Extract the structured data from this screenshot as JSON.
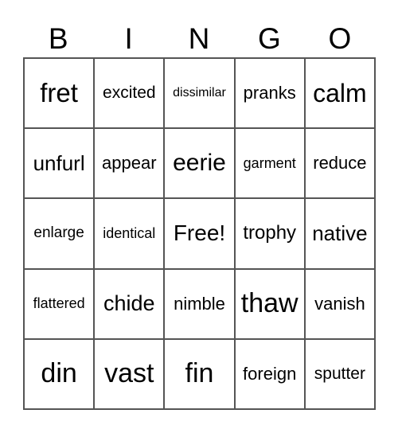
{
  "header": [
    "B",
    "I",
    "N",
    "G",
    "O"
  ],
  "cells": [
    "fret",
    "excited",
    "dissimilar",
    "pranks",
    "calm",
    "unfurl",
    "appear",
    "eerie",
    "garment",
    "reduce",
    "enlarge",
    "identical",
    "Free!",
    "trophy",
    "native",
    "flattered",
    "chide",
    "nimble",
    "thaw",
    "vanish",
    "din",
    "vast",
    "fin",
    "foreign",
    "sputter"
  ]
}
